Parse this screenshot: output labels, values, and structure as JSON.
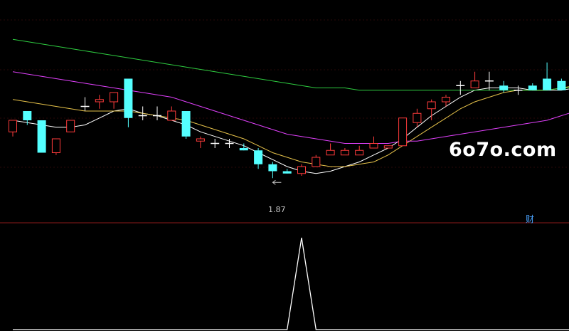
{
  "watermark": "6o7o.com",
  "badge": "财",
  "chart_data": [
    {
      "type": "candlestick",
      "count": 40,
      "ohlc": [
        [
          1.975,
          2.0,
          1.965,
          2.0
        ],
        [
          2.02,
          2.02,
          1.99,
          2.0
        ],
        [
          2.0,
          2.0,
          1.93,
          1.93
        ],
        [
          1.93,
          1.96,
          1.925,
          1.96
        ],
        [
          1.975,
          2.0,
          1.975,
          2.0
        ],
        [
          2.03,
          2.05,
          2.02,
          2.03
        ],
        [
          2.04,
          2.055,
          2.025,
          2.045
        ],
        [
          2.04,
          2.06,
          2.025,
          2.06
        ],
        [
          2.09,
          2.09,
          1.985,
          2.005
        ],
        [
          2.01,
          2.03,
          2.0,
          2.01
        ],
        [
          2.01,
          2.03,
          2.0,
          2.01
        ],
        [
          2.0,
          2.03,
          2.0,
          2.02
        ],
        [
          2.02,
          2.02,
          1.96,
          1.965
        ],
        [
          1.955,
          1.965,
          1.94,
          1.96
        ],
        [
          1.95,
          1.96,
          1.94,
          1.95
        ],
        [
          1.95,
          1.96,
          1.94,
          1.95
        ],
        [
          1.94,
          1.95,
          1.935,
          1.935
        ],
        [
          1.935,
          1.94,
          1.895,
          1.905
        ],
        [
          1.905,
          1.91,
          1.875,
          1.89
        ],
        [
          1.89,
          1.895,
          1.885,
          1.885
        ],
        [
          1.885,
          1.905,
          1.88,
          1.9
        ],
        [
          1.9,
          1.925,
          1.9,
          1.92
        ],
        [
          1.925,
          1.95,
          1.925,
          1.935
        ],
        [
          1.925,
          1.94,
          1.925,
          1.935
        ],
        [
          1.925,
          1.945,
          1.925,
          1.935
        ],
        [
          1.94,
          1.965,
          1.94,
          1.95
        ],
        [
          1.94,
          1.945,
          1.94,
          1.945
        ],
        [
          1.945,
          2.005,
          1.945,
          2.005
        ],
        [
          1.995,
          2.025,
          1.985,
          2.015
        ],
        [
          2.025,
          2.045,
          2.0,
          2.04
        ],
        [
          2.04,
          2.055,
          2.03,
          2.05
        ],
        [
          2.075,
          2.085,
          2.055,
          2.075
        ],
        [
          2.07,
          2.105,
          2.07,
          2.085
        ],
        [
          2.085,
          2.105,
          2.065,
          2.085
        ],
        [
          2.075,
          2.085,
          2.06,
          2.065
        ],
        [
          2.065,
          2.075,
          2.055,
          2.065
        ],
        [
          2.075,
          2.08,
          2.065,
          2.065
        ],
        [
          2.09,
          2.125,
          2.065,
          2.065
        ],
        [
          2.085,
          2.09,
          2.065,
          2.065
        ],
        [
          2.06,
          2.14,
          2.05,
          2.12
        ]
      ],
      "moving_averages": [
        {
          "color": "#ffffff",
          "values": [
            2.0,
            1.995,
            1.99,
            1.985,
            1.985,
            1.99,
            2.005,
            2.02,
            2.025,
            2.015,
            2.01,
            2.0,
            1.99,
            1.975,
            1.965,
            1.955,
            1.945,
            1.93,
            1.915,
            1.9,
            1.89,
            1.885,
            1.89,
            1.9,
            1.91,
            1.925,
            1.94,
            1.96,
            1.985,
            2.01,
            2.03,
            2.05,
            2.065,
            2.07,
            2.07,
            2.07,
            2.065,
            2.065,
            2.065,
            2.07
          ]
        },
        {
          "color": "#e6c24a",
          "values": [
            2.045,
            2.04,
            2.035,
            2.03,
            2.025,
            2.02,
            2.02,
            2.02,
            2.02,
            2.015,
            2.01,
            2.005,
            2.0,
            1.99,
            1.98,
            1.97,
            1.96,
            1.945,
            1.93,
            1.92,
            1.91,
            1.905,
            1.9,
            1.9,
            1.905,
            1.91,
            1.925,
            1.945,
            1.965,
            1.985,
            2.005,
            2.025,
            2.04,
            2.05,
            2.06,
            2.065,
            2.065,
            2.065,
            2.07,
            2.075
          ]
        },
        {
          "color": "#e040fb",
          "values": [
            2.105,
            2.1,
            2.095,
            2.09,
            2.085,
            2.08,
            2.075,
            2.07,
            2.065,
            2.06,
            2.055,
            2.05,
            2.04,
            2.03,
            2.02,
            2.01,
            2.0,
            1.99,
            1.98,
            1.97,
            1.965,
            1.96,
            1.955,
            1.95,
            1.95,
            1.95,
            1.95,
            1.955,
            1.955,
            1.96,
            1.965,
            1.97,
            1.975,
            1.98,
            1.985,
            1.99,
            1.995,
            2.0,
            2.01,
            2.02
          ]
        },
        {
          "color": "#2ecc40",
          "values": [
            2.175,
            2.17,
            2.165,
            2.16,
            2.155,
            2.15,
            2.145,
            2.14,
            2.135,
            2.13,
            2.125,
            2.12,
            2.115,
            2.11,
            2.105,
            2.1,
            2.095,
            2.09,
            2.085,
            2.08,
            2.075,
            2.07,
            2.07,
            2.07,
            2.065,
            2.065,
            2.065,
            2.065,
            2.065,
            2.065,
            2.065,
            2.065,
            2.065,
            2.065,
            2.065,
            2.065,
            2.065,
            2.065,
            2.07,
            2.07
          ]
        }
      ],
      "low_label": "1.87",
      "low_index": 18
    },
    {
      "type": "line",
      "color": "#ffffff",
      "values": [
        0,
        0,
        0,
        0,
        0,
        0,
        0,
        0,
        0,
        0,
        0,
        0,
        0,
        0,
        0,
        0,
        0,
        0,
        0,
        0,
        1,
        0,
        0,
        0,
        0,
        0,
        0,
        0,
        0,
        0,
        0,
        0,
        0,
        0,
        0,
        0,
        0,
        0,
        0,
        0
      ]
    }
  ]
}
